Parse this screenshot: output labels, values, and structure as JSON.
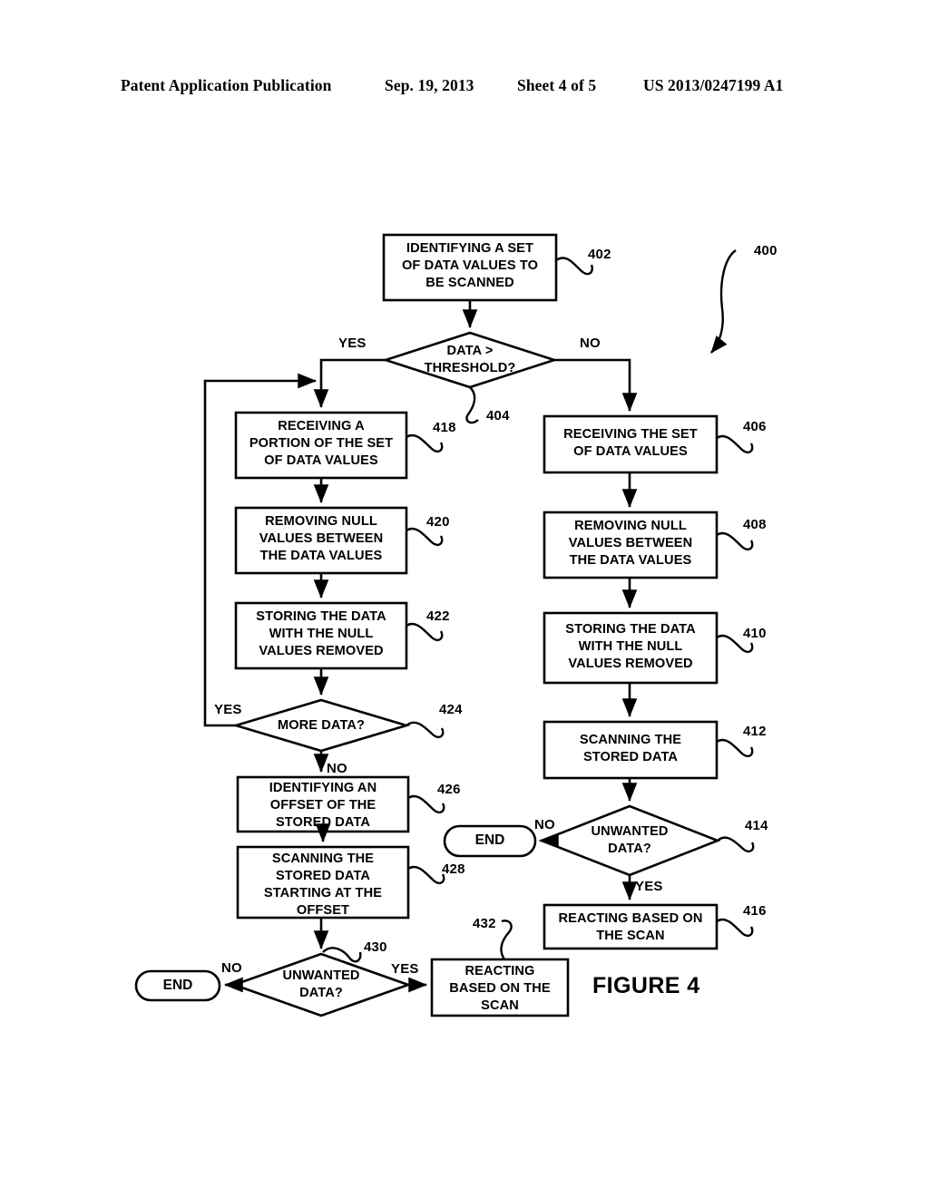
{
  "header": {
    "publication": "Patent Application Publication",
    "date": "Sep. 19, 2013",
    "sheet": "Sheet 4 of 5",
    "patent_number": "US 2013/0247199 A1"
  },
  "figure": {
    "caption": "FIGURE 4",
    "diagram_ref": "400",
    "nodes": {
      "n402": {
        "ref": "402",
        "text": "IDENTIFYING A SET\nOF DATA VALUES TO\nBE SCANNED",
        "shape": "process"
      },
      "n404": {
        "ref": "404",
        "text": "DATA >\nTHRESHOLD?",
        "shape": "decision"
      },
      "n406": {
        "ref": "406",
        "text": "RECEIVING THE SET\nOF DATA VALUES",
        "shape": "process"
      },
      "n408": {
        "ref": "408",
        "text": "REMOVING NULL\nVALUES BETWEEN\nTHE DATA VALUES",
        "shape": "process"
      },
      "n410": {
        "ref": "410",
        "text": "STORING THE DATA\nWITH  THE NULL\nVALUES REMOVED",
        "shape": "process"
      },
      "n412": {
        "ref": "412",
        "text": "SCANNING THE\nSTORED DATA",
        "shape": "process"
      },
      "n414": {
        "ref": "414",
        "text": "UNWANTED\nDATA?",
        "shape": "decision"
      },
      "n416": {
        "ref": "416",
        "text": "REACTING BASED ON\nTHE SCAN",
        "shape": "process"
      },
      "n418": {
        "ref": "418",
        "text": "RECEIVING A\nPORTION OF THE SET\nOF DATA VALUES",
        "shape": "process"
      },
      "n420": {
        "ref": "420",
        "text": "REMOVING NULL\nVALUES BETWEEN\nTHE DATA VALUES",
        "shape": "process"
      },
      "n422": {
        "ref": "422",
        "text": "STORING THE DATA\nWITH  THE NULL\nVALUES REMOVED",
        "shape": "process"
      },
      "n424": {
        "ref": "424",
        "text": "MORE DATA?",
        "shape": "decision"
      },
      "n426": {
        "ref": "426",
        "text": "IDENTIFYING AN\nOFFSET OF THE\nSTORED DATA",
        "shape": "process"
      },
      "n428": {
        "ref": "428",
        "text": "SCANNING THE\nSTORED DATA\nSTARTING AT THE\nOFFSET",
        "shape": "process"
      },
      "n430": {
        "ref": "430",
        "text": "UNWANTED\nDATA?",
        "shape": "decision"
      },
      "n432": {
        "ref": "432",
        "text": "REACTING\nBASED ON THE\nSCAN",
        "shape": "process"
      },
      "end_right": {
        "text": "END",
        "shape": "terminator"
      },
      "end_left": {
        "text": "END",
        "shape": "terminator"
      }
    },
    "edge_labels": {
      "threshold_yes": "YES",
      "threshold_no": "NO",
      "more_data_yes": "YES",
      "more_data_no": "NO",
      "unwanted_right_no": "NO",
      "unwanted_right_yes": "YES",
      "unwanted_left_no": "NO",
      "unwanted_left_yes": "YES"
    }
  },
  "colors": {
    "ink": "#000000",
    "background": "#ffffff"
  }
}
